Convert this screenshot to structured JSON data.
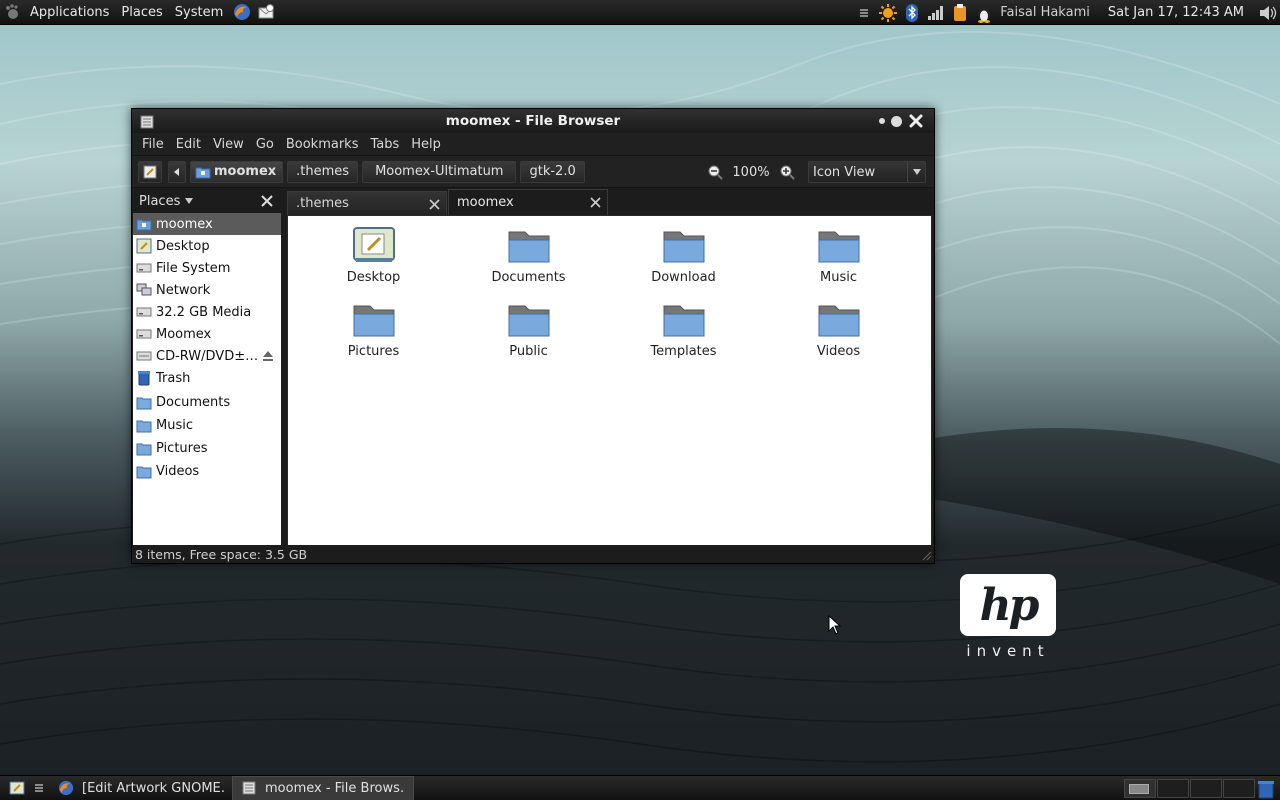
{
  "top_panel": {
    "menus": [
      "Applications",
      "Places",
      "System"
    ],
    "user": "Faisal Hakami",
    "clock": "Sat Jan 17, 12:43 AM"
  },
  "window": {
    "title": "moomex - File Browser",
    "menu": [
      "File",
      "Edit",
      "View",
      "Go",
      "Bookmarks",
      "Tabs",
      "Help"
    ],
    "path": [
      "moomex",
      ".themes",
      "Moomex-Ultimatum",
      "gtk-2.0"
    ],
    "zoom": "100%",
    "view_mode": "Icon View",
    "sidebar_title": "Places",
    "places": [
      {
        "label": "moomex",
        "icon": "home-icon",
        "selected": true
      },
      {
        "label": "Desktop",
        "icon": "desktop-icon"
      },
      {
        "label": "File System",
        "icon": "drive-icon"
      },
      {
        "label": "Network",
        "icon": "network-icon"
      },
      {
        "label": "32.2 GB Media",
        "icon": "drive-icon"
      },
      {
        "label": "Moomex",
        "icon": "drive-icon"
      },
      {
        "label": "CD-RW/DVD±…",
        "icon": "optical-drive-icon",
        "eject": true
      },
      {
        "label": "Trash",
        "icon": "trash-icon"
      },
      {
        "label": "Documents",
        "icon": "folder-icon"
      },
      {
        "label": "Music",
        "icon": "folder-icon"
      },
      {
        "label": "Pictures",
        "icon": "folder-icon"
      },
      {
        "label": "Videos",
        "icon": "folder-icon"
      }
    ],
    "tabs": [
      {
        "label": ".themes",
        "active": false
      },
      {
        "label": "moomex",
        "active": true
      }
    ],
    "files": [
      {
        "label": "Desktop",
        "icon": "desktop-folder-icon"
      },
      {
        "label": "Documents",
        "icon": "folder-icon"
      },
      {
        "label": "Download",
        "icon": "folder-icon"
      },
      {
        "label": "Music",
        "icon": "folder-icon"
      },
      {
        "label": "Pictures",
        "icon": "folder-icon"
      },
      {
        "label": "Public",
        "icon": "folder-icon"
      },
      {
        "label": "Templates",
        "icon": "folder-icon"
      },
      {
        "label": "Videos",
        "icon": "folder-icon"
      }
    ],
    "status": "8 items, Free space: 3.5 GB"
  },
  "desktop": {
    "logo": "hp",
    "logo_tagline": "invent"
  },
  "bottom_panel": {
    "tasks": [
      {
        "label": "[Edit Artwork GNOME…",
        "icon": "firefox-icon",
        "active": false
      },
      {
        "label": "moomex - File Brows…",
        "icon": "file-browser-icon",
        "active": true
      }
    ]
  }
}
